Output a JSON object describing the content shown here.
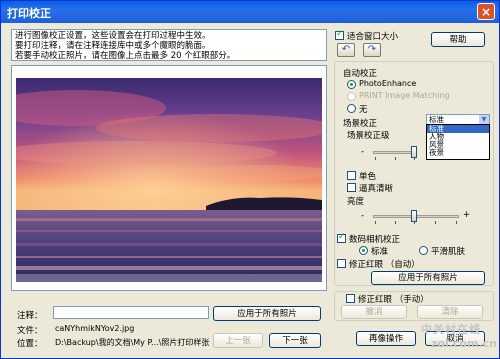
{
  "window": {
    "title": "打印校正",
    "close_glyph": "×"
  },
  "instructions": {
    "line1": "进行图像校正设置，这些设置会在打印过程中生效。",
    "line2": "要打印注释，请在注释连接库中或多个魔眼的脆面。",
    "line3": "若要手动校正照片，请在图像上点击最多 20 个红眼部分。"
  },
  "fit_window": {
    "label": "适合窗口大小",
    "checked": true
  },
  "rotate_left_glyph": "↶",
  "rotate_right_glyph": "↷",
  "help_button": "帮助",
  "auto_correction": {
    "title": "自动校正",
    "options": [
      "PhotoEnhance",
      "PRINT Image Matching",
      "无"
    ],
    "selected": 0
  },
  "scene": {
    "label": "场景校正",
    "selected": "标准",
    "options": [
      "标准",
      "人物",
      "风景",
      "夜景"
    ],
    "level_label": "场景校正级",
    "minus": "-",
    "plus": "+"
  },
  "monochrome": {
    "label": "单色",
    "checked": false
  },
  "sharpen": {
    "label": "逼真清晰",
    "checked": false
  },
  "brightness": {
    "label": "亮度",
    "minus": "-",
    "plus": "+"
  },
  "digital_camera": {
    "label": "数码相机校正",
    "checked": true,
    "options": [
      "标准",
      "平滑肌肤"
    ],
    "selected": 0
  },
  "auto_redeye": {
    "label": "修正红眼 （自动）",
    "checked": false
  },
  "apply_all_right": "应用于所有照片",
  "manual_redeye": {
    "label": "修正红眼 （手动）",
    "checked": false
  },
  "undo_button": "撤消",
  "clear_button": "清除",
  "restore_button": "再像操作",
  "cancel_button": "取消",
  "note": {
    "label": "注释：",
    "value": "",
    "apply_all": "应用于所有照片"
  },
  "file": {
    "label": "文件：",
    "value": "caNYhmikNYov2.jpg"
  },
  "location": {
    "label": "位置：",
    "value": "D:\\Backup\\我的文档\\My P...\\照片打印样张"
  },
  "prev_button": "上一张",
  "next_button": "下一张",
  "watermark": {
    "text": "中关村在线",
    "sub": "zol.com.cn"
  },
  "colors": {
    "title_bar": "#0a5fe4",
    "window_bg": "#ece9d8",
    "selection": "#316ac5",
    "checkmark": "#21a121"
  }
}
